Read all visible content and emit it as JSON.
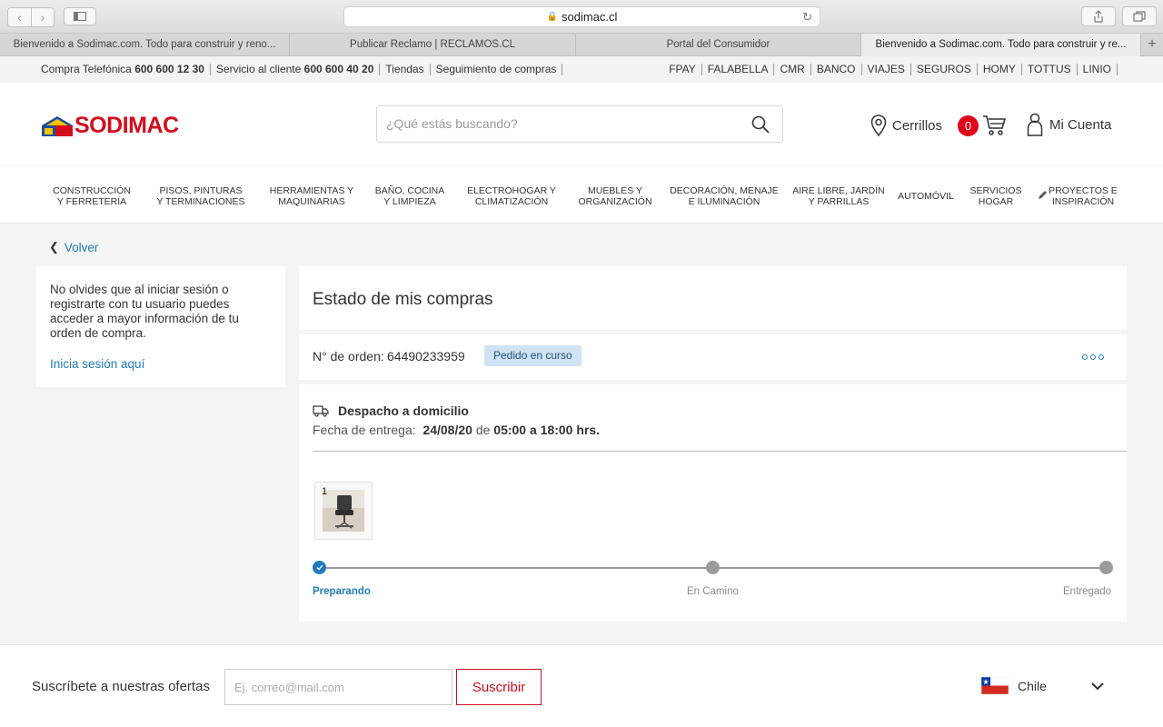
{
  "browser": {
    "url": "sodimac.cl",
    "tabs": [
      {
        "label": "Bienvenido a Sodimac.com. Todo para construir y reno..."
      },
      {
        "label": "Publicar Reclamo | RECLAMOS.CL"
      },
      {
        "label": "Portal del Consumidor"
      },
      {
        "label": "Bienvenido a Sodimac.com. Todo para construir y re..."
      }
    ]
  },
  "topstrip": {
    "phone_label": "Compra Telefónica",
    "phone_number": "600 600 12 30",
    "service_label": "Servicio al cliente",
    "service_number": "600 600 40 20",
    "stores": "Tiendas",
    "tracking": "Seguimiento de compras",
    "brands": [
      "FPAY",
      "FALABELLA",
      "CMR",
      "BANCO",
      "VIAJES",
      "SEGUROS",
      "HOMY",
      "TOTTUS",
      "LINIO"
    ]
  },
  "header": {
    "logo_text": "SODIMAC",
    "search_placeholder": "¿Qué estás buscando?",
    "location": "Cerrillos",
    "cart_count": "0",
    "account": "Mi Cuenta"
  },
  "categories": [
    "CONSTRUCCIÓN Y FERRETERÍA",
    "PISOS, PINTURAS Y TERMINACIONES",
    "HERRAMIENTAS Y MAQUINARIAS",
    "BAÑO, COCINA Y LIMPIEZA",
    "ELECTROHOGAR Y CLIMATIZACIÓN",
    "MUEBLES Y ORGANIZACIÓN",
    "DECORACIÓN, MENAJE E ILUMINACIÓN",
    "AIRE LIBRE, JARDÍN Y PARRILLAS",
    "AUTOMÓVIL",
    "SERVICIOS HOGAR",
    "PROYECTOS E INSPIRACIÓN"
  ],
  "page": {
    "back_label": "Volver",
    "login_message": "No olvides que al iniciar sesión o registrarte con tu usuario puedes acceder a mayor información de tu orden de compra.",
    "login_link": "Inicia sesión aquí",
    "title": "Estado de mis compras",
    "order_label": "N° de orden:",
    "order_number": "64490233959",
    "order_status": "Pedido en curso",
    "delivery_type": "Despacho a domicilio",
    "delivery_date_label": "Fecha de entrega:",
    "delivery_date": "24/08/20",
    "delivery_de": "de",
    "delivery_time": "05:00 a 18:00 hrs.",
    "product_qty": "1",
    "steps": [
      "Preparando",
      "En Camino",
      "Entregado"
    ],
    "active_step": 0
  },
  "footer": {
    "subscribe_label": "Suscríbete a nuestras ofertas",
    "email_placeholder": "Ej. correo@mail.com",
    "subscribe_button": "Suscribir",
    "country": "Chile"
  },
  "colors": {
    "brand_red": "#d30d1c",
    "link_blue": "#1e7bbd",
    "badge_bg": "#cfe3f4"
  }
}
